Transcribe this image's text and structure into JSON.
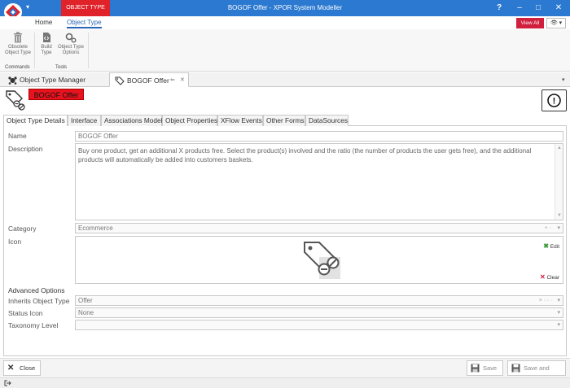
{
  "titlebar": {
    "context_tab": "OBJECT TYPE",
    "title": "BOGOF Offer - XPOR System Modeller",
    "help": "?",
    "minimize": "–",
    "maximize": "□",
    "close": "✕",
    "menu_caret": "▾"
  },
  "ribbon": {
    "tabs": [
      "Home",
      "Object Type"
    ],
    "view_all": "View All",
    "eye_menu": "👁 ▾",
    "buttons": {
      "obsolete": "Obsolete Object Type",
      "build": "Build Type",
      "options": "Object Type Options"
    },
    "groups": {
      "commands": "Commands",
      "tools": "Tools"
    }
  },
  "doctabs": {
    "manager": "Object Type Manager",
    "current": "BOGOF Offer",
    "pin": "⇐",
    "close": "✕",
    "overflow": "▾"
  },
  "header": {
    "name_badge": "BOGOF Offer",
    "alert": "!"
  },
  "form_tabs": [
    "Object Type Details",
    "Interface",
    "Associations Model",
    "Object Properties",
    "XFlow Events",
    "Other Forms",
    "DataSources"
  ],
  "form": {
    "name_label": "Name",
    "name_value": "BOGOF Offer",
    "description_label": "Description",
    "description_value": "Buy one product, get an additional X products free. Select the product(s) involved and the ratio (the number of products the user gets free), and the additional products will automatically be added into customers baskets.",
    "category_label": "Category",
    "category_value": "Ecommerce",
    "category_extra": "+ ·",
    "icon_label": "Icon",
    "icon_edit": "Edit",
    "icon_clear": "Clear",
    "advanced_title": "Advanced Options",
    "inherits_label": "Inherits Object Type",
    "inherits_value": "Offer",
    "inherits_extra": "× ··· ·",
    "status_icon_label": "Status Icon",
    "status_icon_value": "None",
    "taxonomy_label": "Taxonomy Level",
    "taxonomy_value": ""
  },
  "footer": {
    "close": "Close",
    "save": "Save",
    "save_close": "Save and Close"
  },
  "colors": {
    "titlebar": "#2b79d0",
    "context_tab": "#e0222a",
    "view_all": "#d0203e",
    "active_tab": "#2b65b5"
  }
}
